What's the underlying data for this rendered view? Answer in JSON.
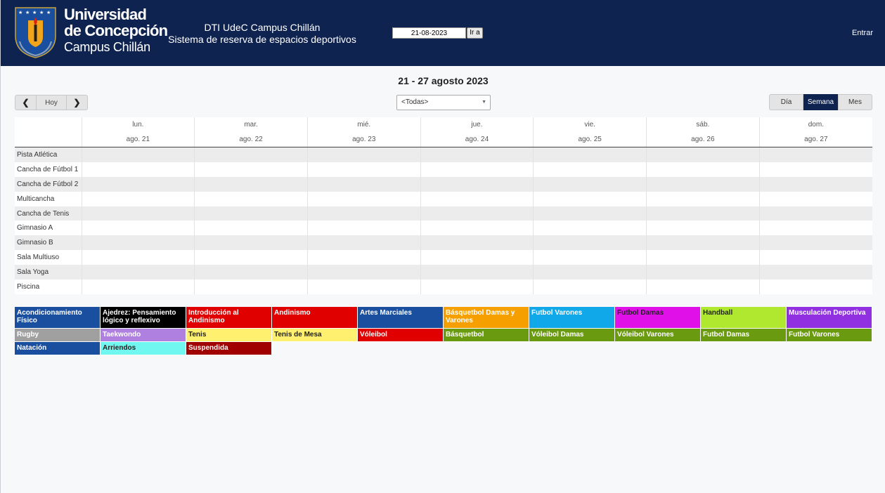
{
  "header": {
    "uni_line1": "Universidad",
    "uni_line2": "de Concepción",
    "uni_line3": "Campus Chillán",
    "sys_line1": "DTI UdeC Campus Chillán",
    "sys_line2": "Sistema de reserva de espacios deportivos",
    "date_value": "21-08-2023",
    "go_label": "Ir a",
    "login_label": "Entrar",
    "bg_color": "#0f2350"
  },
  "calendar": {
    "range_title": "21 - 27 agosto 2023",
    "prev_icon": "❮",
    "today_label": "Hoy",
    "next_icon": "❯",
    "filter_value": "<Todas>",
    "views": {
      "day": "Día",
      "week": "Semana",
      "month": "Mes"
    },
    "active_view": "Semana",
    "days": [
      {
        "name": "lun.",
        "date": "ago. 21"
      },
      {
        "name": "mar.",
        "date": "ago. 22"
      },
      {
        "name": "mié.",
        "date": "ago. 23"
      },
      {
        "name": "jue.",
        "date": "ago. 24"
      },
      {
        "name": "vie.",
        "date": "ago. 25"
      },
      {
        "name": "sáb.",
        "date": "ago. 26"
      },
      {
        "name": "dom.",
        "date": "ago. 27"
      }
    ],
    "resources": [
      "Pista Atlética",
      "Cancha de Fútbol 1",
      "Cancha de Fútbol 2",
      "Multicancha",
      "Cancha de Tenis",
      "Gimnasio A",
      "Gimnasio B",
      "Sala Multiuso",
      "Sala Yoga",
      "Piscina"
    ]
  },
  "legend": [
    [
      {
        "label": "Acondicionamiento Físico",
        "bg": "#1a4fa0",
        "fg": "#ffffff"
      },
      {
        "label": "Ajedrez: Pensamiento lógico y reflexivo",
        "bg": "#000000",
        "fg": "#ffffff"
      },
      {
        "label": "Introducción al Andinismo",
        "bg": "#e00000",
        "fg": "#ffffff"
      },
      {
        "label": "Andinismo",
        "bg": "#e00000",
        "fg": "#ffffff"
      },
      {
        "label": "Artes Marciales",
        "bg": "#1a4fa0",
        "fg": "#ffffff"
      },
      {
        "label": "Básquetbol Damas y Varones",
        "bg": "#f5a000",
        "fg": "#ffffff"
      },
      {
        "label": "Futbol Varones",
        "bg": "#10a8e8",
        "fg": "#ffffff"
      },
      {
        "label": "Futbol Damas",
        "bg": "#e010e8",
        "fg": "#222222"
      },
      {
        "label": "Handball",
        "bg": "#b0e830",
        "fg": "#222222"
      },
      {
        "label": "Musculación Deportiva",
        "bg": "#9030e0",
        "fg": "#ffffff"
      }
    ],
    [
      {
        "label": "Rugby",
        "bg": "#a0a0a0",
        "fg": "#ffffff"
      },
      {
        "label": "Taekwondo",
        "bg": "#b080e0",
        "fg": "#ffffff"
      },
      {
        "label": "Tenis",
        "bg": "#fff070",
        "fg": "#222222"
      },
      {
        "label": "Tenis de Mesa",
        "bg": "#fff070",
        "fg": "#222222"
      },
      {
        "label": "Vóleibol",
        "bg": "#e00000",
        "fg": "#ffffff"
      },
      {
        "label": "Básquetbol",
        "bg": "#6a9a10",
        "fg": "#ffffff"
      },
      {
        "label": "Vóleibol Damas",
        "bg": "#6a9a10",
        "fg": "#ffffff"
      },
      {
        "label": "Vóleibol Varones",
        "bg": "#6a9a10",
        "fg": "#ffffff"
      },
      {
        "label": "Futbol Damas",
        "bg": "#6a9a10",
        "fg": "#ffffff"
      },
      {
        "label": "Futbol Varones",
        "bg": "#6a9a10",
        "fg": "#ffffff"
      }
    ],
    [
      {
        "label": "Natación",
        "bg": "#1a4fa0",
        "fg": "#ffffff"
      },
      {
        "label": "Arriendos",
        "bg": "#70f8f0",
        "fg": "#222222"
      },
      {
        "label": "Suspendida",
        "bg": "#a00000",
        "fg": "#ffffff"
      }
    ]
  ]
}
